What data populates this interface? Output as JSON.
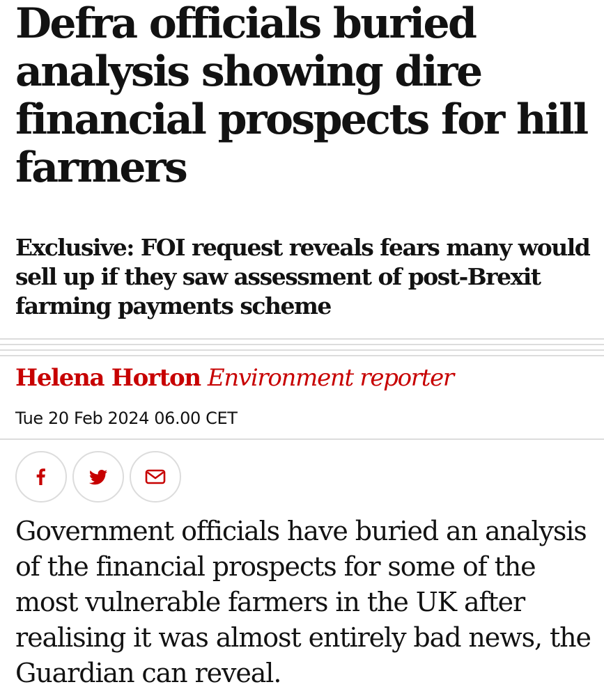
{
  "article": {
    "headline": "Defra officials buried analysis showing dire financial prospects for hill farmers",
    "standfirst": "Exclusive: FOI request reveals fears many would sell up if they saw assessment of post-Brexit farming payments scheme",
    "byline": {
      "author": "Helena Horton",
      "role": "Environment reporter"
    },
    "dateline": "Tue 20 Feb 2024 06.00 CET",
    "body": "Government officials have buried an analysis of the financial prospects for some of the most vulnerable farmers in the UK after realising it was almost entirely bad news, the Guardian can reveal."
  },
  "share": {
    "buttons": [
      {
        "icon": "facebook-icon"
      },
      {
        "icon": "twitter-icon"
      },
      {
        "icon": "email-icon"
      }
    ]
  },
  "colors": {
    "accent": "#c70000",
    "text": "#121212",
    "rule": "#dcdcdc",
    "background": "#ffffff"
  }
}
